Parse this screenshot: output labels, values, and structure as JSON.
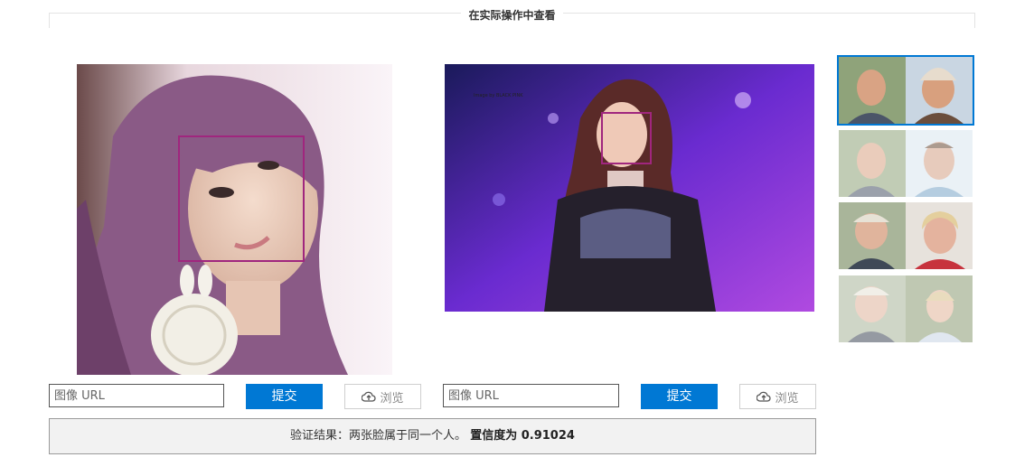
{
  "section": {
    "title": "在实际操作中查看"
  },
  "left_panel": {
    "url_placeholder": "图像 URL",
    "submit_label": "提交",
    "browse_label": "浏览"
  },
  "right_panel": {
    "url_placeholder": "图像 URL",
    "submit_label": "提交",
    "browse_label": "浏览",
    "watermark": "Image by BLACK PINK"
  },
  "thumbnails": [
    {
      "label": "sample-pair-1",
      "selected": true
    },
    {
      "label": "sample-pair-2",
      "selected": false
    },
    {
      "label": "sample-pair-3",
      "selected": false
    },
    {
      "label": "sample-pair-4",
      "selected": false
    }
  ],
  "result": {
    "text": "验证结果：两张脸属于同一个人。",
    "confidence_label": "置信度为 0.91024"
  },
  "icons": {
    "browse": "cloud-upload-icon"
  },
  "colors": {
    "accent": "#0078d4",
    "face_box": "#a0267e"
  }
}
